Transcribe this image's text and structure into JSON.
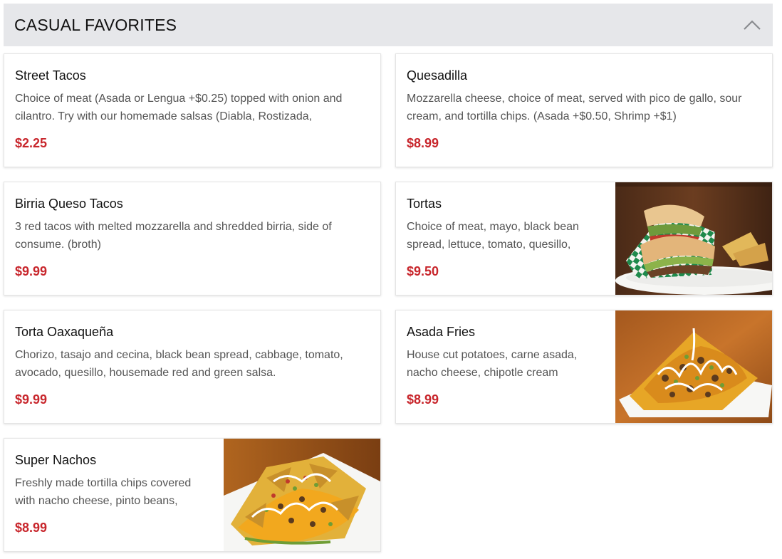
{
  "section": {
    "title": "CASUAL FAVORITES",
    "collapse_icon": "chevron-up-icon"
  },
  "items": [
    {
      "name": "Street Tacos",
      "description": "Choice of meat (Asada or Lengua +$0.25) topped with onion and cilantro. Try with our homemade salsas (Diabla, Rostizada,",
      "price": "$2.25",
      "has_image": false
    },
    {
      "name": "Quesadilla",
      "description": "Mozzarella cheese, choice of meat, served with pico de gallo, sour cream, and tortilla chips. (Asada +$0.50, Shrimp +$1)",
      "price": "$8.99",
      "has_image": false
    },
    {
      "name": "Birria Queso Tacos",
      "description": "3 red tacos with melted mozzarella and shredded birria, side of consume. (broth)",
      "price": "$9.99",
      "has_image": false
    },
    {
      "name": "Tortas",
      "description": "Choice of meat, mayo, black bean spread, lettuce, tomato, quesillo,",
      "price": "$9.50",
      "has_image": true,
      "image_icon": "torta-sandwich-photo"
    },
    {
      "name": "Torta Oaxaqueña",
      "description": "Chorizo, tasajo and cecina, black bean spread, cabbage, tomato, avocado, quesillo, housemade red and green salsa.",
      "price": "$9.99",
      "has_image": false
    },
    {
      "name": "Asada Fries",
      "description": "House cut potatoes, carne asada, nacho cheese, chipotle cream",
      "price": "$8.99",
      "has_image": true,
      "image_icon": "asada-fries-photo"
    },
    {
      "name": "Super Nachos",
      "description": "Freshly made tortilla chips covered with nacho cheese, pinto beans,",
      "price": "$8.99",
      "has_image": true,
      "image_icon": "super-nachos-photo"
    }
  ],
  "colors": {
    "header_bg": "#e6e7ea",
    "price": "#c8262c",
    "description": "#555555"
  }
}
